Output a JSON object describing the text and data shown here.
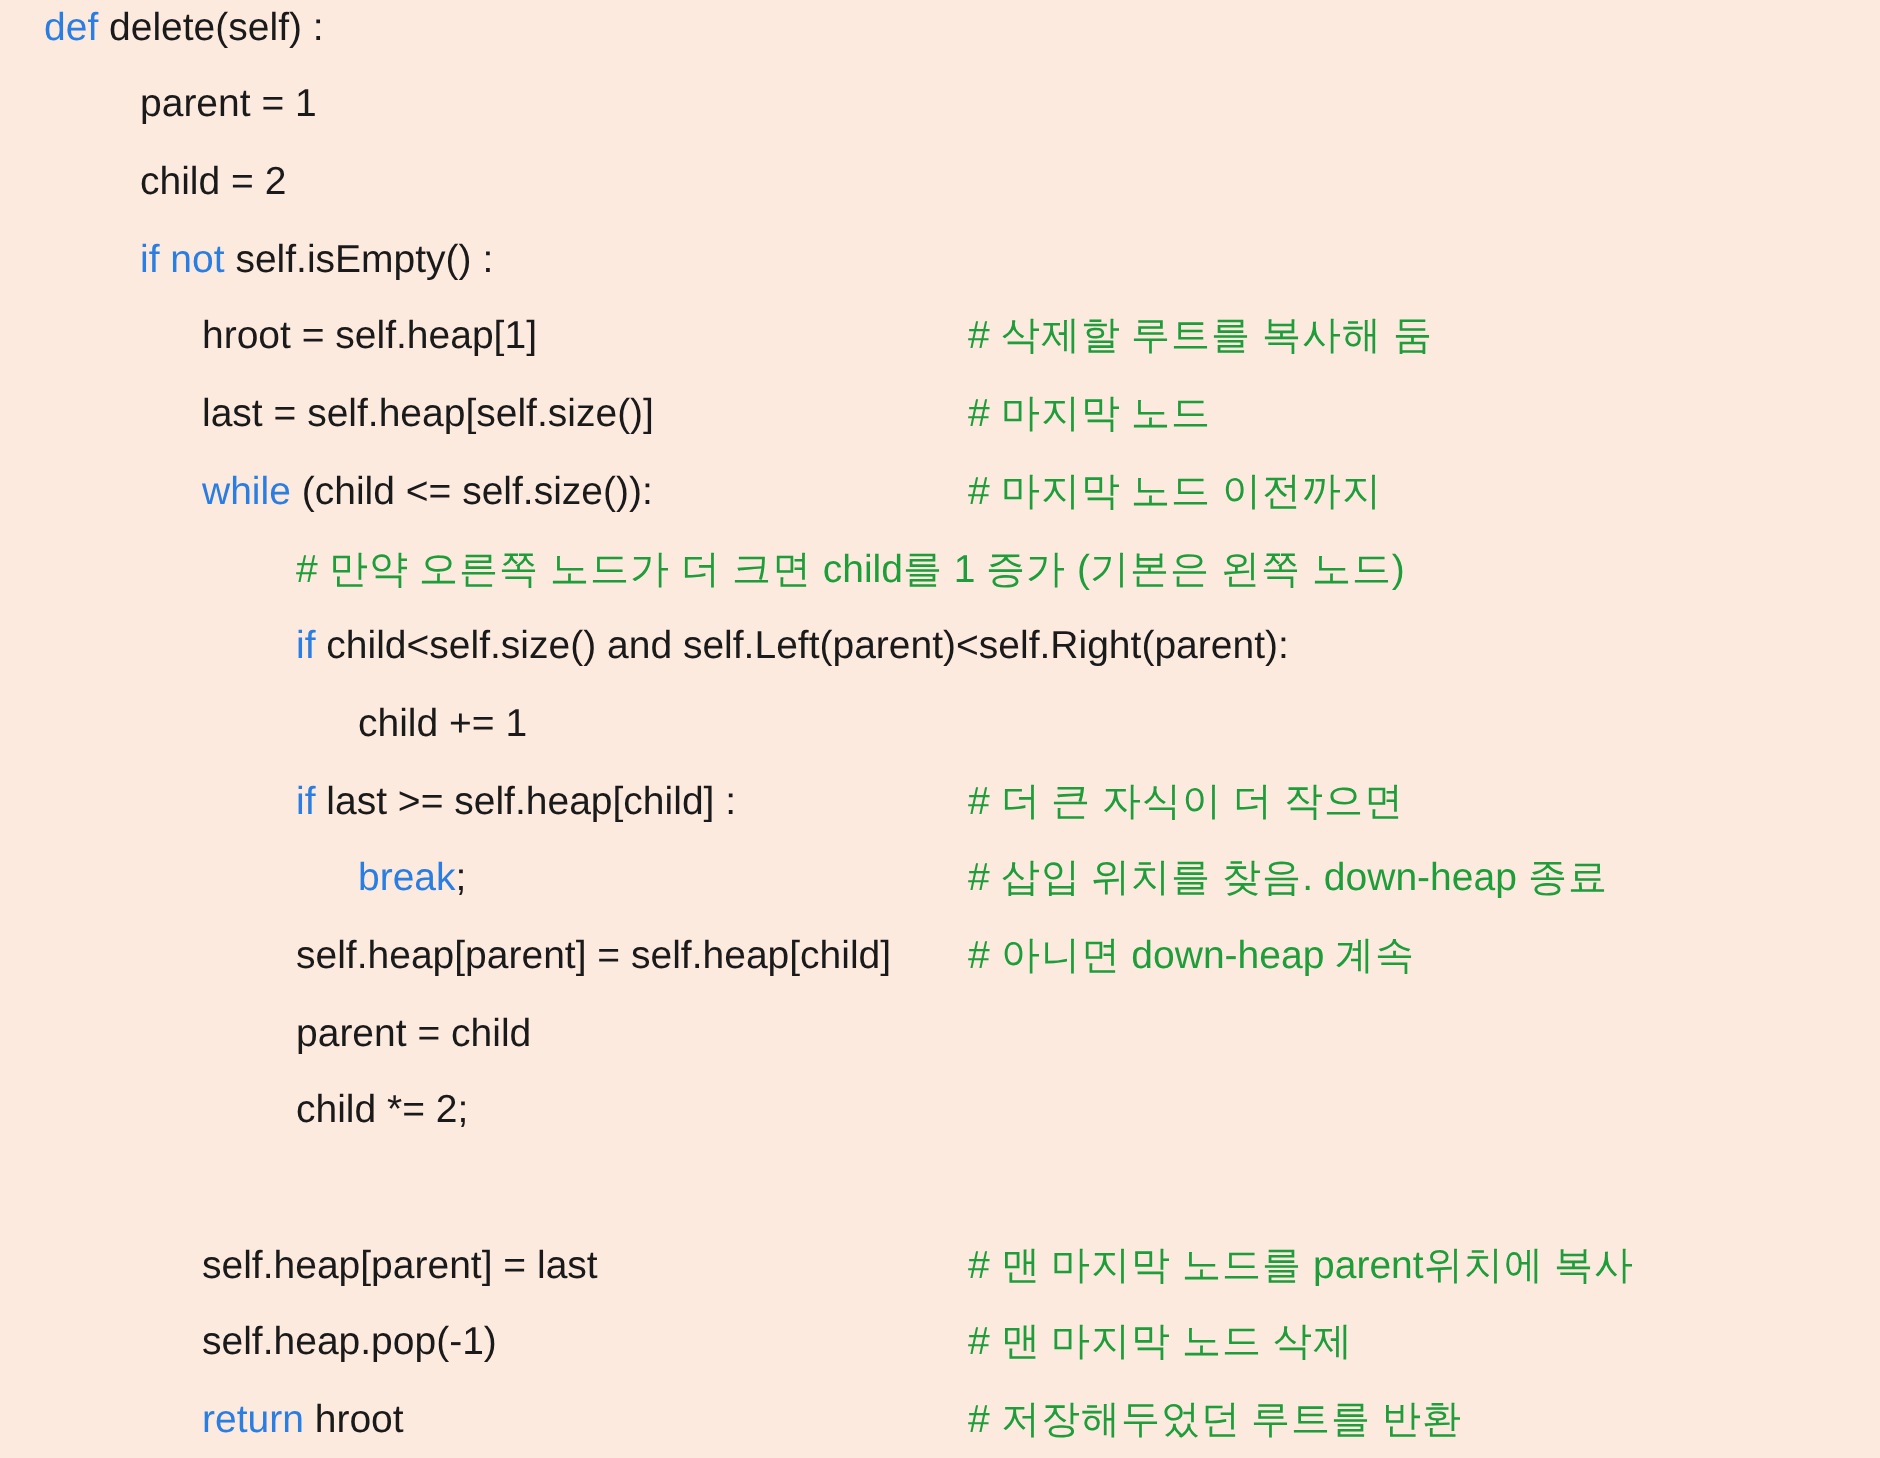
{
  "code_listing": {
    "lines": [
      {
        "kind": "code",
        "segments": [
          {
            "kind": "keyword",
            "text": "def"
          },
          {
            "kind": "code",
            "text": " delete(self) :"
          }
        ],
        "children": [
          {
            "kind": "code",
            "segments": [
              {
                "kind": "code",
                "text": "parent = 1"
              }
            ]
          },
          {
            "kind": "code",
            "segments": [
              {
                "kind": "code",
                "text": "child = 2"
              }
            ]
          },
          {
            "kind": "code",
            "segments": [
              {
                "kind": "keyword",
                "text": "if not"
              },
              {
                "kind": "code",
                "text": " self.isEmpty() :"
              }
            ],
            "children": [
              {
                "kind": "code",
                "segments": [
                  {
                    "kind": "code",
                    "text": "hroot = self.heap[1]"
                  }
                ],
                "comment": "# 삭제할 루트를 복사해 둠"
              },
              {
                "kind": "code",
                "segments": [
                  {
                    "kind": "code",
                    "text": "last = self.heap[self.size()]"
                  }
                ],
                "comment": "# 마지막 노드"
              },
              {
                "kind": "code",
                "segments": [
                  {
                    "kind": "keyword",
                    "text": "while"
                  },
                  {
                    "kind": "code",
                    "text": " (child <= self.size()):"
                  }
                ],
                "comment": "# 마지막 노드 이전까지",
                "children": [
                  {
                    "kind": "comment",
                    "comment": "# 만약 오른쪽 노드가 더 크면 child를 1 증가 (기본은 왼쪽 노드)"
                  },
                  {
                    "kind": "code",
                    "segments": [
                      {
                        "kind": "keyword",
                        "text": "if"
                      },
                      {
                        "kind": "code",
                        "text": " child<self.size() and self.Left(parent)<self.Right(parent):"
                      }
                    ],
                    "children": [
                      {
                        "kind": "code",
                        "segments": [
                          {
                            "kind": "code",
                            "text": "child += 1"
                          }
                        ]
                      }
                    ]
                  },
                  {
                    "kind": "code",
                    "segments": [
                      {
                        "kind": "keyword",
                        "text": "if"
                      },
                      {
                        "kind": "code",
                        "text": " last >= self.heap[child] :"
                      }
                    ],
                    "comment": "# 더 큰 자식이 더 작으면",
                    "children": [
                      {
                        "kind": "code",
                        "segments": [
                          {
                            "kind": "keyword",
                            "text": "break"
                          },
                          {
                            "kind": "code",
                            "text": ";"
                          }
                        ],
                        "comment": "# 삽입 위치를 찾음. down-heap 종료"
                      }
                    ]
                  },
                  {
                    "kind": "code",
                    "segments": [
                      {
                        "kind": "code",
                        "text": "self.heap[parent] = self.heap[child]"
                      }
                    ],
                    "comment": "# 아니면 down-heap 계속"
                  },
                  {
                    "kind": "code",
                    "segments": [
                      {
                        "kind": "code",
                        "text": "parent = child"
                      }
                    ]
                  },
                  {
                    "kind": "code",
                    "segments": [
                      {
                        "kind": "code",
                        "text": "child *= 2;"
                      }
                    ]
                  }
                ]
              },
              {
                "kind": "blank"
              },
              {
                "kind": "code",
                "segments": [
                  {
                    "kind": "code",
                    "text": "self.heap[parent] = last"
                  }
                ],
                "comment": "# 맨 마지막 노드를 parent위치에 복사"
              },
              {
                "kind": "code",
                "segments": [
                  {
                    "kind": "code",
                    "text": "self.heap.pop(-1)"
                  }
                ],
                "comment": "# 맨 마지막 노드 삭제"
              },
              {
                "kind": "code",
                "segments": [
                  {
                    "kind": "keyword",
                    "text": "return"
                  },
                  {
                    "kind": "code",
                    "text": " hroot"
                  }
                ],
                "comment": "# 저장해두었던 루트를 반환"
              }
            ]
          }
        ]
      }
    ]
  }
}
